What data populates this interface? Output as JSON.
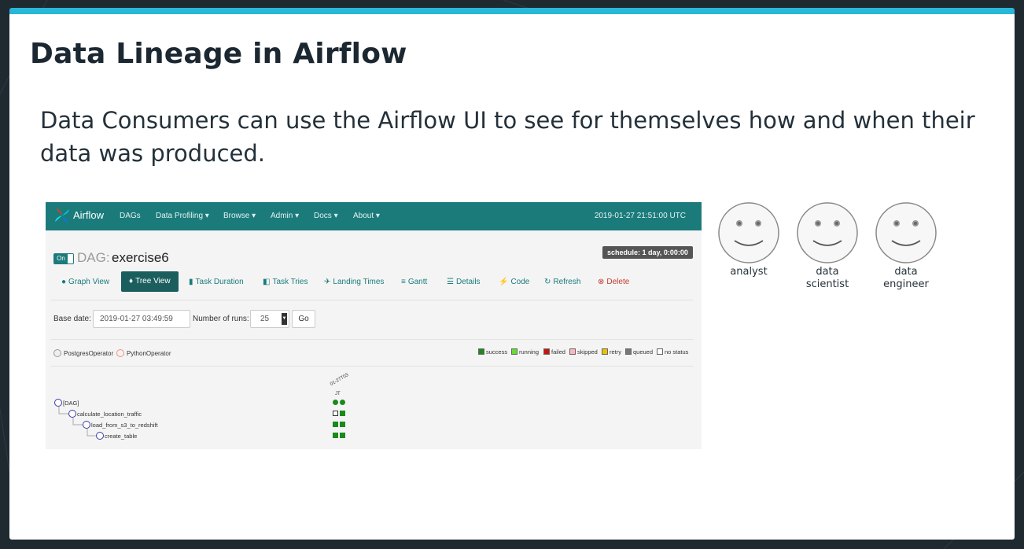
{
  "slide": {
    "title": "Data Lineage in Airflow",
    "body": "Data Consumers can use the Airflow UI to see for themselves how and when their data was produced."
  },
  "airflow": {
    "brand": "Airflow",
    "menu": [
      "DAGs",
      "Data Profiling",
      "Browse",
      "Admin",
      "Docs",
      "About"
    ],
    "timestamp": "2019-01-27 21:51:00 UTC",
    "schedule": "schedule: 1 day, 0:00:00",
    "on_label": "On",
    "dag_label": "DAG:",
    "dag_id": "exercise6",
    "tabs": [
      "Graph View",
      "Tree View",
      "Task Duration",
      "Task Tries",
      "Landing Times",
      "Gantt",
      "Details",
      "Code",
      "Refresh",
      "Delete"
    ],
    "active_tab": "Tree View",
    "base_date_label": "Base date:",
    "base_date_value": "2019-01-27 03:49:59",
    "runs_label": "Number of runs:",
    "runs_value": "25",
    "go_label": "Go",
    "operators": [
      {
        "name": "PostgresOperator",
        "color": "#eeeeee"
      },
      {
        "name": "PythonOperator",
        "color": "#ffefeb"
      }
    ],
    "legend": [
      {
        "label": "success",
        "color": "#1a8a1a"
      },
      {
        "label": "running",
        "color": "#66dd33"
      },
      {
        "label": "failed",
        "color": "#cc1111"
      },
      {
        "label": "skipped",
        "color": "#ffb6c1"
      },
      {
        "label": "retry",
        "color": "#f0c000"
      },
      {
        "label": "queued",
        "color": "#777777"
      },
      {
        "label": "no status",
        "color": "#ffffff"
      }
    ],
    "tree": [
      "[DAG]",
      "calculate_location_traffic",
      "load_from_s3_to_redshift",
      "create_table"
    ],
    "run_header_1": "01-27T03",
    "run_header_2": "JT"
  },
  "personas": [
    "analyst",
    "data\nscientist",
    "data\nengineer"
  ],
  "colors": {
    "accent": "#29b7d9",
    "airflow_teal": "#1b7b7b",
    "background": "#1f2a30"
  }
}
